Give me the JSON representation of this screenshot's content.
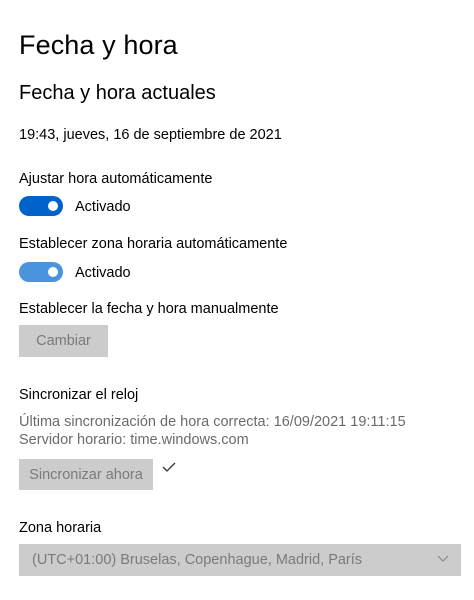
{
  "page": {
    "title": "Fecha y hora",
    "section_title": "Fecha y hora actuales",
    "current_datetime": "19:43, jueves, 16 de septiembre de 2021"
  },
  "auto_time": {
    "label": "Ajustar hora automáticamente",
    "state_label": "Activado",
    "on": true,
    "color": "#0063cc"
  },
  "auto_timezone": {
    "label": "Establecer zona horaria automáticamente",
    "state_label": "Activado",
    "on": true,
    "color": "#4a94dd"
  },
  "manual": {
    "label": "Establecer la fecha y hora manualmente",
    "button_label": "Cambiar"
  },
  "sync": {
    "heading": "Sincronizar el reloj",
    "last_sync": "Última sincronización de hora correcta: 16/09/2021 19:11:15",
    "server": "Servidor horario: time.windows.com",
    "button_label": "Sincronizar ahora",
    "status_icon": "checkmark-icon"
  },
  "timezone": {
    "label": "Zona horaria",
    "selected": "(UTC+01:00) Bruselas, Copenhague, Madrid, París"
  }
}
